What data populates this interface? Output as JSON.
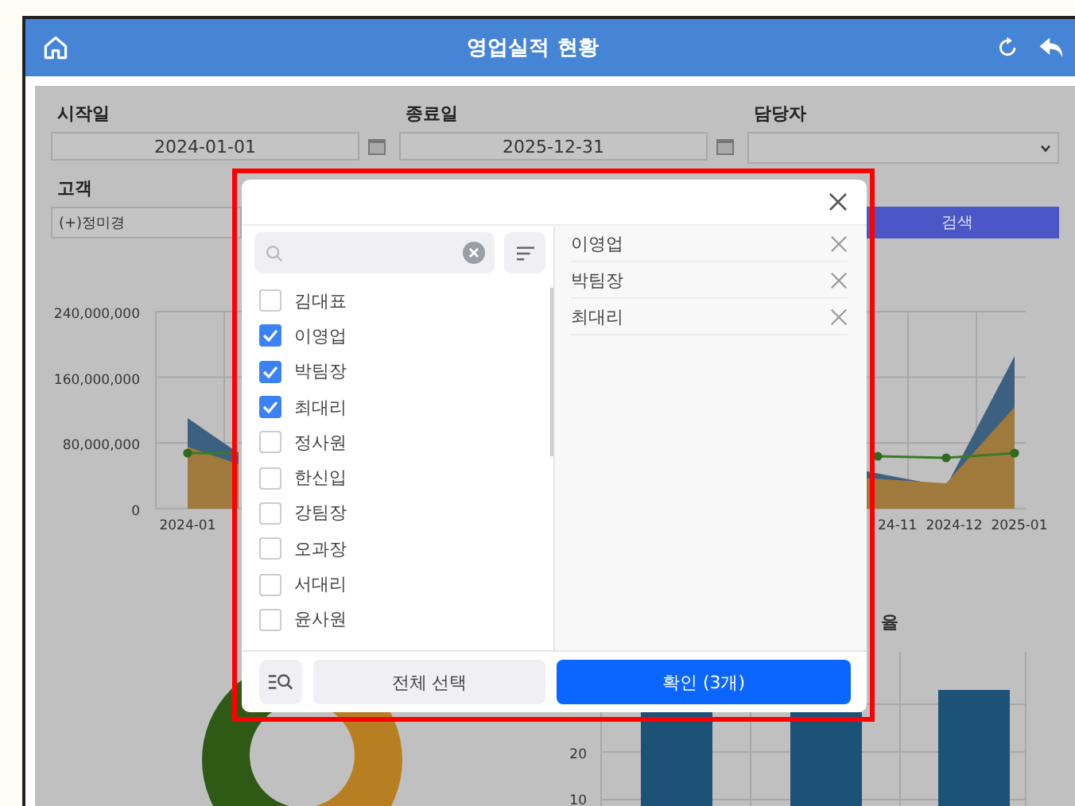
{
  "header": {
    "title": "영업실적 현황"
  },
  "filters": {
    "start_date": {
      "label": "시작일",
      "value": "2024-01-01"
    },
    "end_date": {
      "label": "종료일",
      "value": "2025-12-31"
    },
    "manager": {
      "label": "담당자"
    },
    "customer": {
      "label": "고객",
      "value": "(+)정미경"
    },
    "search_button": "검색"
  },
  "area_chart": {
    "y_labels": [
      "240,000,000",
      "160,000,000",
      "80,000,000",
      "0"
    ],
    "x_labels": [
      "2024-01",
      "24-11",
      "2024-12",
      "2025-01"
    ]
  },
  "bar_chart": {
    "title_fragment": "율",
    "y_labels": [
      "20",
      "10"
    ]
  },
  "picker": {
    "options": [
      {
        "label": "김대표",
        "checked": false
      },
      {
        "label": "이영업",
        "checked": true
      },
      {
        "label": "박팀장",
        "checked": true
      },
      {
        "label": "최대리",
        "checked": true
      },
      {
        "label": "정사원",
        "checked": false
      },
      {
        "label": "한신입",
        "checked": false
      },
      {
        "label": "강팀장",
        "checked": false
      },
      {
        "label": "오과장",
        "checked": false
      },
      {
        "label": "서대리",
        "checked": false
      },
      {
        "label": "윤사원",
        "checked": false
      }
    ],
    "selected_items": [
      "이영업",
      "박팀장",
      "최대리"
    ],
    "select_all_button": "전체 선택",
    "confirm_button": "확인 (3개)"
  }
}
